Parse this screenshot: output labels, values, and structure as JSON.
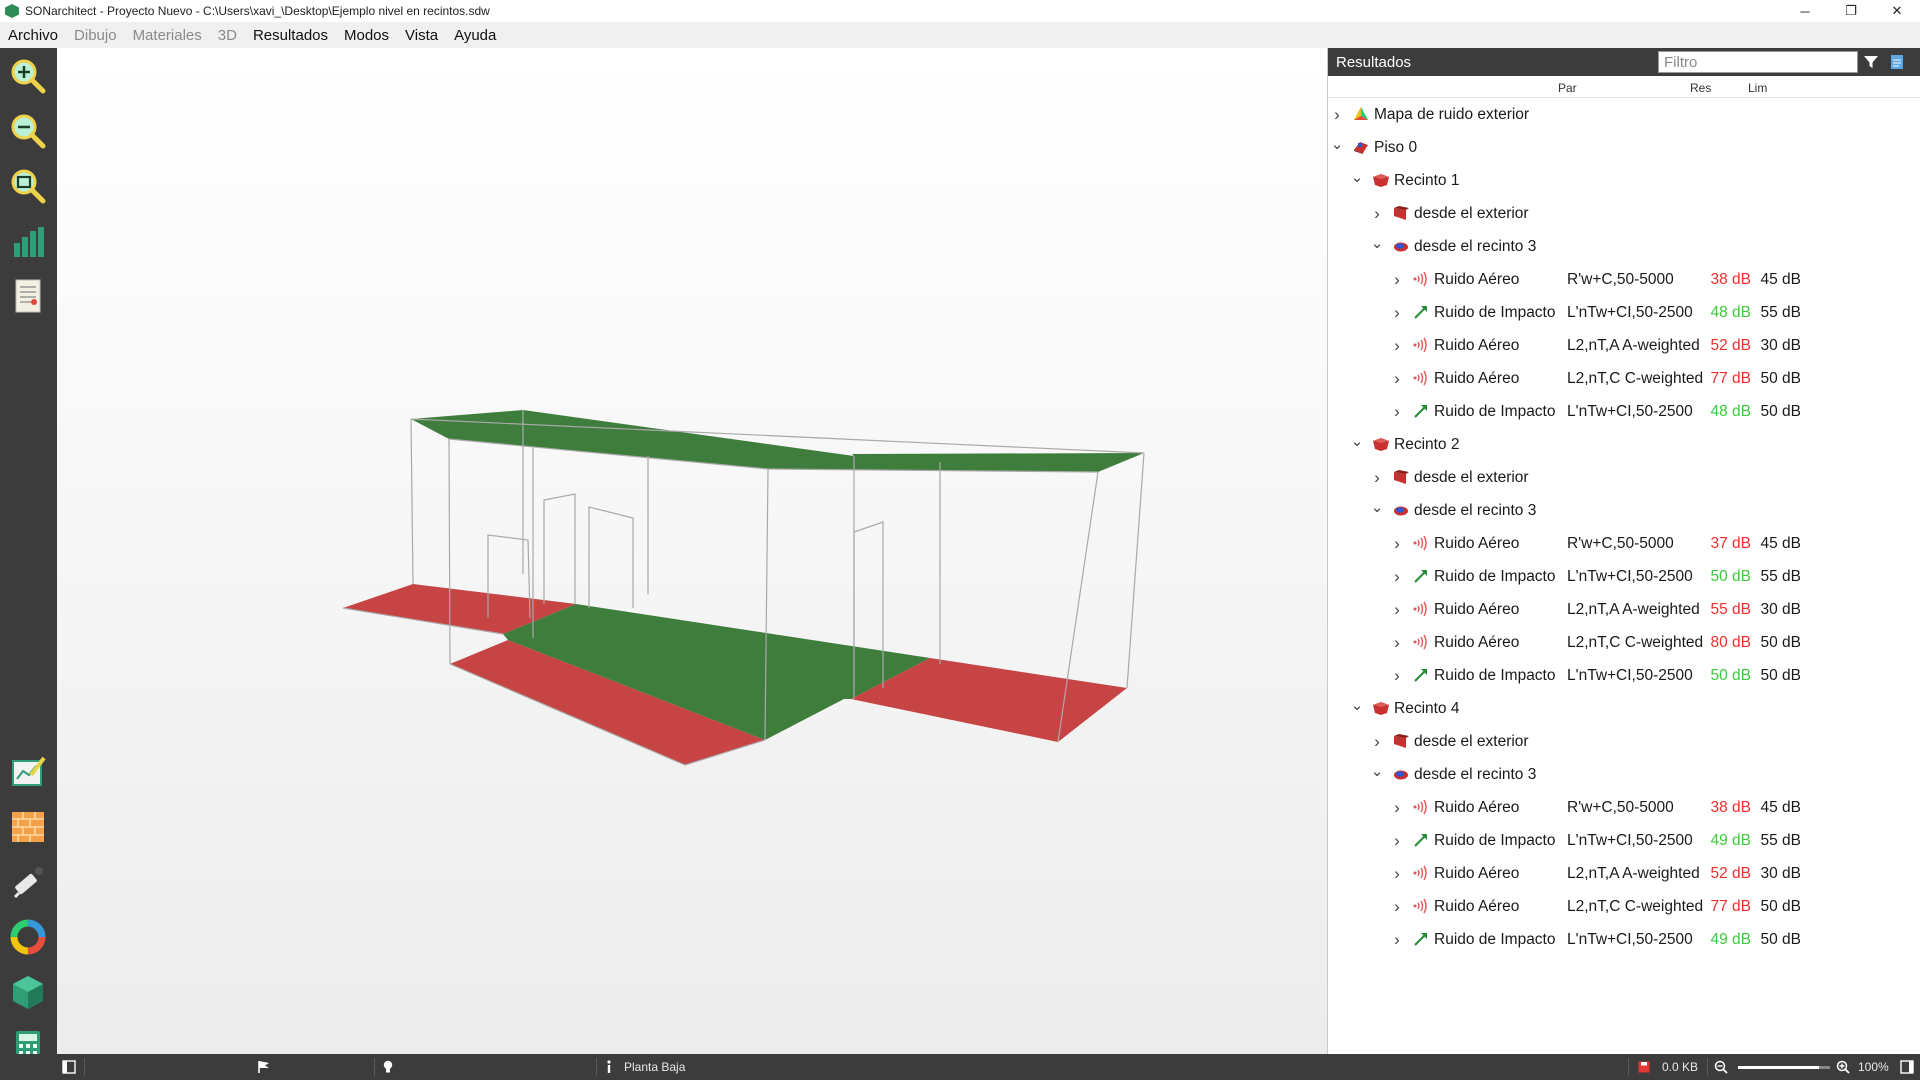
{
  "window": {
    "title": "SONarchitect - Proyecto Nuevo - C:\\Users\\xavi_\\Desktop\\Ejemplo nivel en recintos.sdw",
    "minimize": "─",
    "maximize": "❐",
    "close": "✕"
  },
  "menu": [
    {
      "label": "Archivo",
      "enabled": true
    },
    {
      "label": "Dibujo",
      "enabled": false
    },
    {
      "label": "Materiales",
      "enabled": false
    },
    {
      "label": "3D",
      "enabled": false
    },
    {
      "label": "Resultados",
      "enabled": true
    },
    {
      "label": "Modos",
      "enabled": true
    },
    {
      "label": "Vista",
      "enabled": true
    },
    {
      "label": "Ayuda",
      "enabled": true
    }
  ],
  "toolbar": {
    "tools": [
      "zoom-in-icon",
      "zoom-out-icon",
      "zoom-fit-icon",
      "bar-chart-icon",
      "report-icon",
      "edit-plan-icon",
      "brick-wall-icon",
      "measure-icon",
      "color-wheel-icon",
      "cube-icon",
      "calculator-icon"
    ]
  },
  "colors": {
    "dark_bg": "#3c3c3c",
    "fail": "#e8312f",
    "pass": "#3ec93e",
    "room_red": "#c8312f",
    "floor_green": "#3e7d3c",
    "floor_red": "#c74444"
  },
  "results": {
    "title": "Resultados",
    "filter_placeholder": "Filtro",
    "columns": {
      "par": "Par",
      "res": "Res",
      "lim": "Lim"
    },
    "rows": [
      {
        "level": 0,
        "expanded": false,
        "icon": "noise-map-icon",
        "label": "Mapa de ruido exterior"
      },
      {
        "level": 0,
        "expanded": true,
        "icon": "floor-icon",
        "label": "Piso 0"
      },
      {
        "level": 1,
        "expanded": true,
        "icon": "room-icon",
        "label": "Recinto 1"
      },
      {
        "level": 2,
        "expanded": false,
        "icon": "exterior-icon",
        "label": "desde el exterior"
      },
      {
        "level": 2,
        "expanded": true,
        "icon": "adjacent-room-icon",
        "label": "desde el recinto 3"
      },
      {
        "level": 3,
        "expanded": false,
        "icon": "airborne-noise-icon",
        "label": "Ruido Aéreo",
        "par": "R'w+C,50-5000",
        "res": "38 dB",
        "lim": "45 dB",
        "pass": false
      },
      {
        "level": 3,
        "expanded": false,
        "icon": "impact-noise-icon",
        "label": "Ruido de Impacto",
        "par": "L'nTw+CI,50-2500",
        "res": "48 dB",
        "lim": "55 dB",
        "pass": true
      },
      {
        "level": 3,
        "expanded": false,
        "icon": "airborne-noise-icon",
        "label": "Ruido Aéreo",
        "par": "L2,nT,A A-weighted",
        "res": "52 dB",
        "lim": "30 dB",
        "pass": false
      },
      {
        "level": 3,
        "expanded": false,
        "icon": "airborne-noise-icon",
        "label": "Ruido Aéreo",
        "par": "L2,nT,C C-weighted",
        "res": "77 dB",
        "lim": "50 dB",
        "pass": false
      },
      {
        "level": 3,
        "expanded": false,
        "icon": "impact-noise-icon",
        "label": "Ruido de Impacto",
        "par": "L'nTw+CI,50-2500",
        "res": "48 dB",
        "lim": "50 dB",
        "pass": true
      },
      {
        "level": 1,
        "expanded": true,
        "icon": "room-icon",
        "label": "Recinto 2"
      },
      {
        "level": 2,
        "expanded": false,
        "icon": "exterior-icon",
        "label": "desde el exterior"
      },
      {
        "level": 2,
        "expanded": true,
        "icon": "adjacent-room-icon",
        "label": "desde el recinto 3"
      },
      {
        "level": 3,
        "expanded": false,
        "icon": "airborne-noise-icon",
        "label": "Ruido Aéreo",
        "par": "R'w+C,50-5000",
        "res": "37 dB",
        "lim": "45 dB",
        "pass": false
      },
      {
        "level": 3,
        "expanded": false,
        "icon": "impact-noise-icon",
        "label": "Ruido de Impacto",
        "par": "L'nTw+CI,50-2500",
        "res": "50 dB",
        "lim": "55 dB",
        "pass": true
      },
      {
        "level": 3,
        "expanded": false,
        "icon": "airborne-noise-icon",
        "label": "Ruido Aéreo",
        "par": "L2,nT,A A-weighted",
        "res": "55 dB",
        "lim": "30 dB",
        "pass": false
      },
      {
        "level": 3,
        "expanded": false,
        "icon": "airborne-noise-icon",
        "label": "Ruido Aéreo",
        "par": "L2,nT,C C-weighted",
        "res": "80 dB",
        "lim": "50 dB",
        "pass": false
      },
      {
        "level": 3,
        "expanded": false,
        "icon": "impact-noise-icon",
        "label": "Ruido de Impacto",
        "par": "L'nTw+CI,50-2500",
        "res": "50 dB",
        "lim": "50 dB",
        "pass": true
      },
      {
        "level": 1,
        "expanded": true,
        "icon": "room-icon",
        "label": "Recinto 4"
      },
      {
        "level": 2,
        "expanded": false,
        "icon": "exterior-icon",
        "label": "desde el exterior"
      },
      {
        "level": 2,
        "expanded": true,
        "icon": "adjacent-room-icon",
        "label": "desde el recinto 3"
      },
      {
        "level": 3,
        "expanded": false,
        "icon": "airborne-noise-icon",
        "label": "Ruido Aéreo",
        "par": "R'w+C,50-5000",
        "res": "38 dB",
        "lim": "45 dB",
        "pass": false
      },
      {
        "level": 3,
        "expanded": false,
        "icon": "impact-noise-icon",
        "label": "Ruido de Impacto",
        "par": "L'nTw+CI,50-2500",
        "res": "49 dB",
        "lim": "55 dB",
        "pass": true
      },
      {
        "level": 3,
        "expanded": false,
        "icon": "airborne-noise-icon",
        "label": "Ruido Aéreo",
        "par": "L2,nT,A A-weighted",
        "res": "52 dB",
        "lim": "30 dB",
        "pass": false
      },
      {
        "level": 3,
        "expanded": false,
        "icon": "airborne-noise-icon",
        "label": "Ruido Aéreo",
        "par": "L2,nT,C C-weighted",
        "res": "77 dB",
        "lim": "50 dB",
        "pass": false
      },
      {
        "level": 3,
        "expanded": false,
        "icon": "impact-noise-icon",
        "label": "Ruido de Impacto",
        "par": "L'nTw+CI,50-2500",
        "res": "49 dB",
        "lim": "50 dB",
        "pass": true
      }
    ]
  },
  "statusbar": {
    "floor": "Planta Baja",
    "file_size": "0.0 KB",
    "zoom": "100%",
    "zoom_fraction": 0.88
  }
}
